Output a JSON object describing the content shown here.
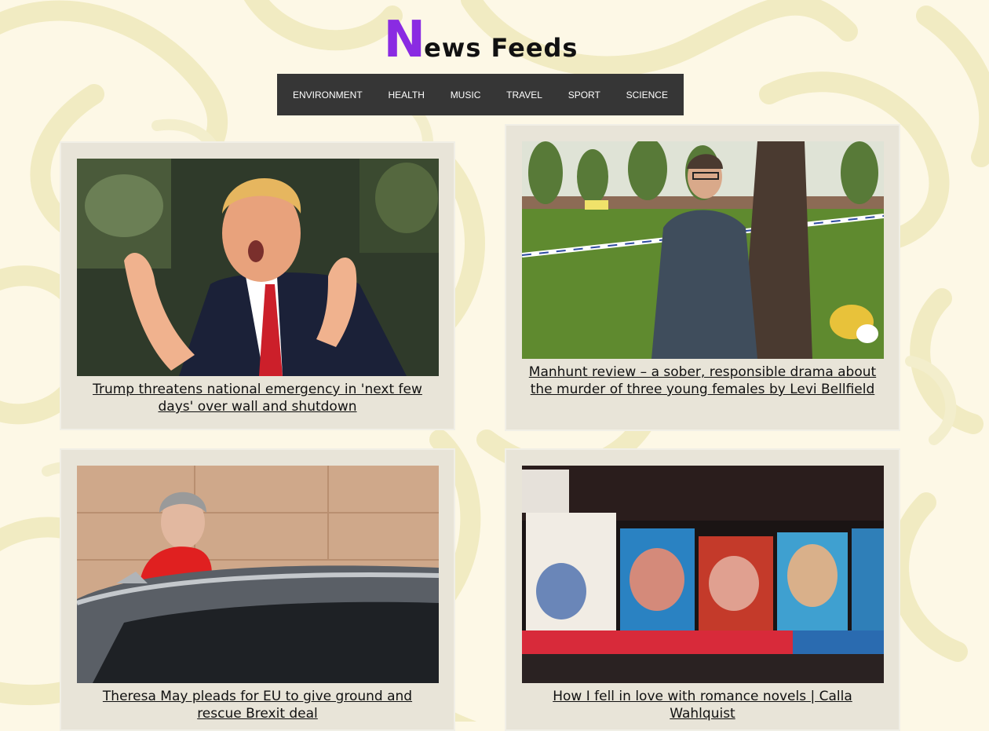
{
  "logo": {
    "initial": "N",
    "rest": "ews Feeds"
  },
  "nav": {
    "items": [
      {
        "label": "ENVIRONMENT"
      },
      {
        "label": "HEALTH"
      },
      {
        "label": "MUSIC"
      },
      {
        "label": "TRAVEL"
      },
      {
        "label": "SPORT"
      },
      {
        "label": "SCIENCE"
      }
    ]
  },
  "articles": [
    {
      "headline": "Trump threatens national emergency in 'next few days' over wall and shutdown",
      "image": "trump-speaking-photo"
    },
    {
      "headline": "Manhunt review – a sober, responsible drama about the murder of three young females by Levi Bellfield",
      "image": "detective-by-tree-photo"
    },
    {
      "headline": "Theresa May pleads for EU to give ground and rescue Brexit deal",
      "image": "theresa-may-car-photo"
    },
    {
      "headline": "How I fell in love with romance novels | Calla Wahlquist",
      "image": "romance-novels-shelf-photo"
    }
  ],
  "colors": {
    "logo_accent": "#8a2be2",
    "nav_bg": "#363636",
    "card_bg": "#e8e4d8",
    "page_bg": "#fdf8e6"
  }
}
